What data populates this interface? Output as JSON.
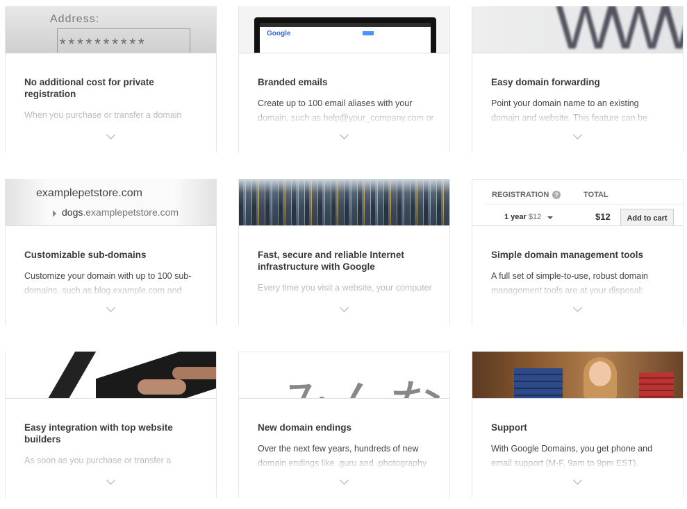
{
  "cards": [
    {
      "title": "No additional cost for private registration",
      "body": "When you purchase or transfer a domain",
      "image": {
        "label": "Address:",
        "mask": "**********"
      }
    },
    {
      "title": "Branded emails",
      "body": "Create up to 100 email aliases with your domain, such as help@your_company.com or",
      "image": {
        "logo": "Google"
      }
    },
    {
      "title": "Easy domain forwarding",
      "body": "Point your domain name to an existing domain and website. This feature can be",
      "image": {
        "text": "WWW."
      }
    },
    {
      "title": "Customizable sub-domains",
      "body": "Customize your domain with up to 100 sub-domains, such as blog.example.com and",
      "image": {
        "domain": "examplepetstore.com",
        "sub_prefix": "dogs",
        "sub_suffix": ".examplepetstore.com"
      }
    },
    {
      "title": "Fast, secure and reliable Internet infrastructure with Google",
      "body": "Every time you visit a website, your computer",
      "image": {}
    },
    {
      "title": "Simple domain management tools",
      "body": "A full set of simple-to-use, robust domain management tools are at your disposal:",
      "image": {
        "registration": "REGISTRATION",
        "total": "TOTAL",
        "term": "1 year",
        "term_price": "$12",
        "total_price": "$12",
        "add_to_cart": "Add to cart"
      }
    },
    {
      "title": "Easy integration with top website builders",
      "body": "As soon as you purchase or transfer a",
      "image": {}
    },
    {
      "title": "New domain endings",
      "body": "Over the next few years, hundreds of new domain endings like .guru and .photography",
      "image": {
        "text": "みんな"
      }
    },
    {
      "title": "Support",
      "body": "With Google Domains, you get phone and email support (M-F, 9am to 9pm EST).",
      "image": {}
    }
  ]
}
